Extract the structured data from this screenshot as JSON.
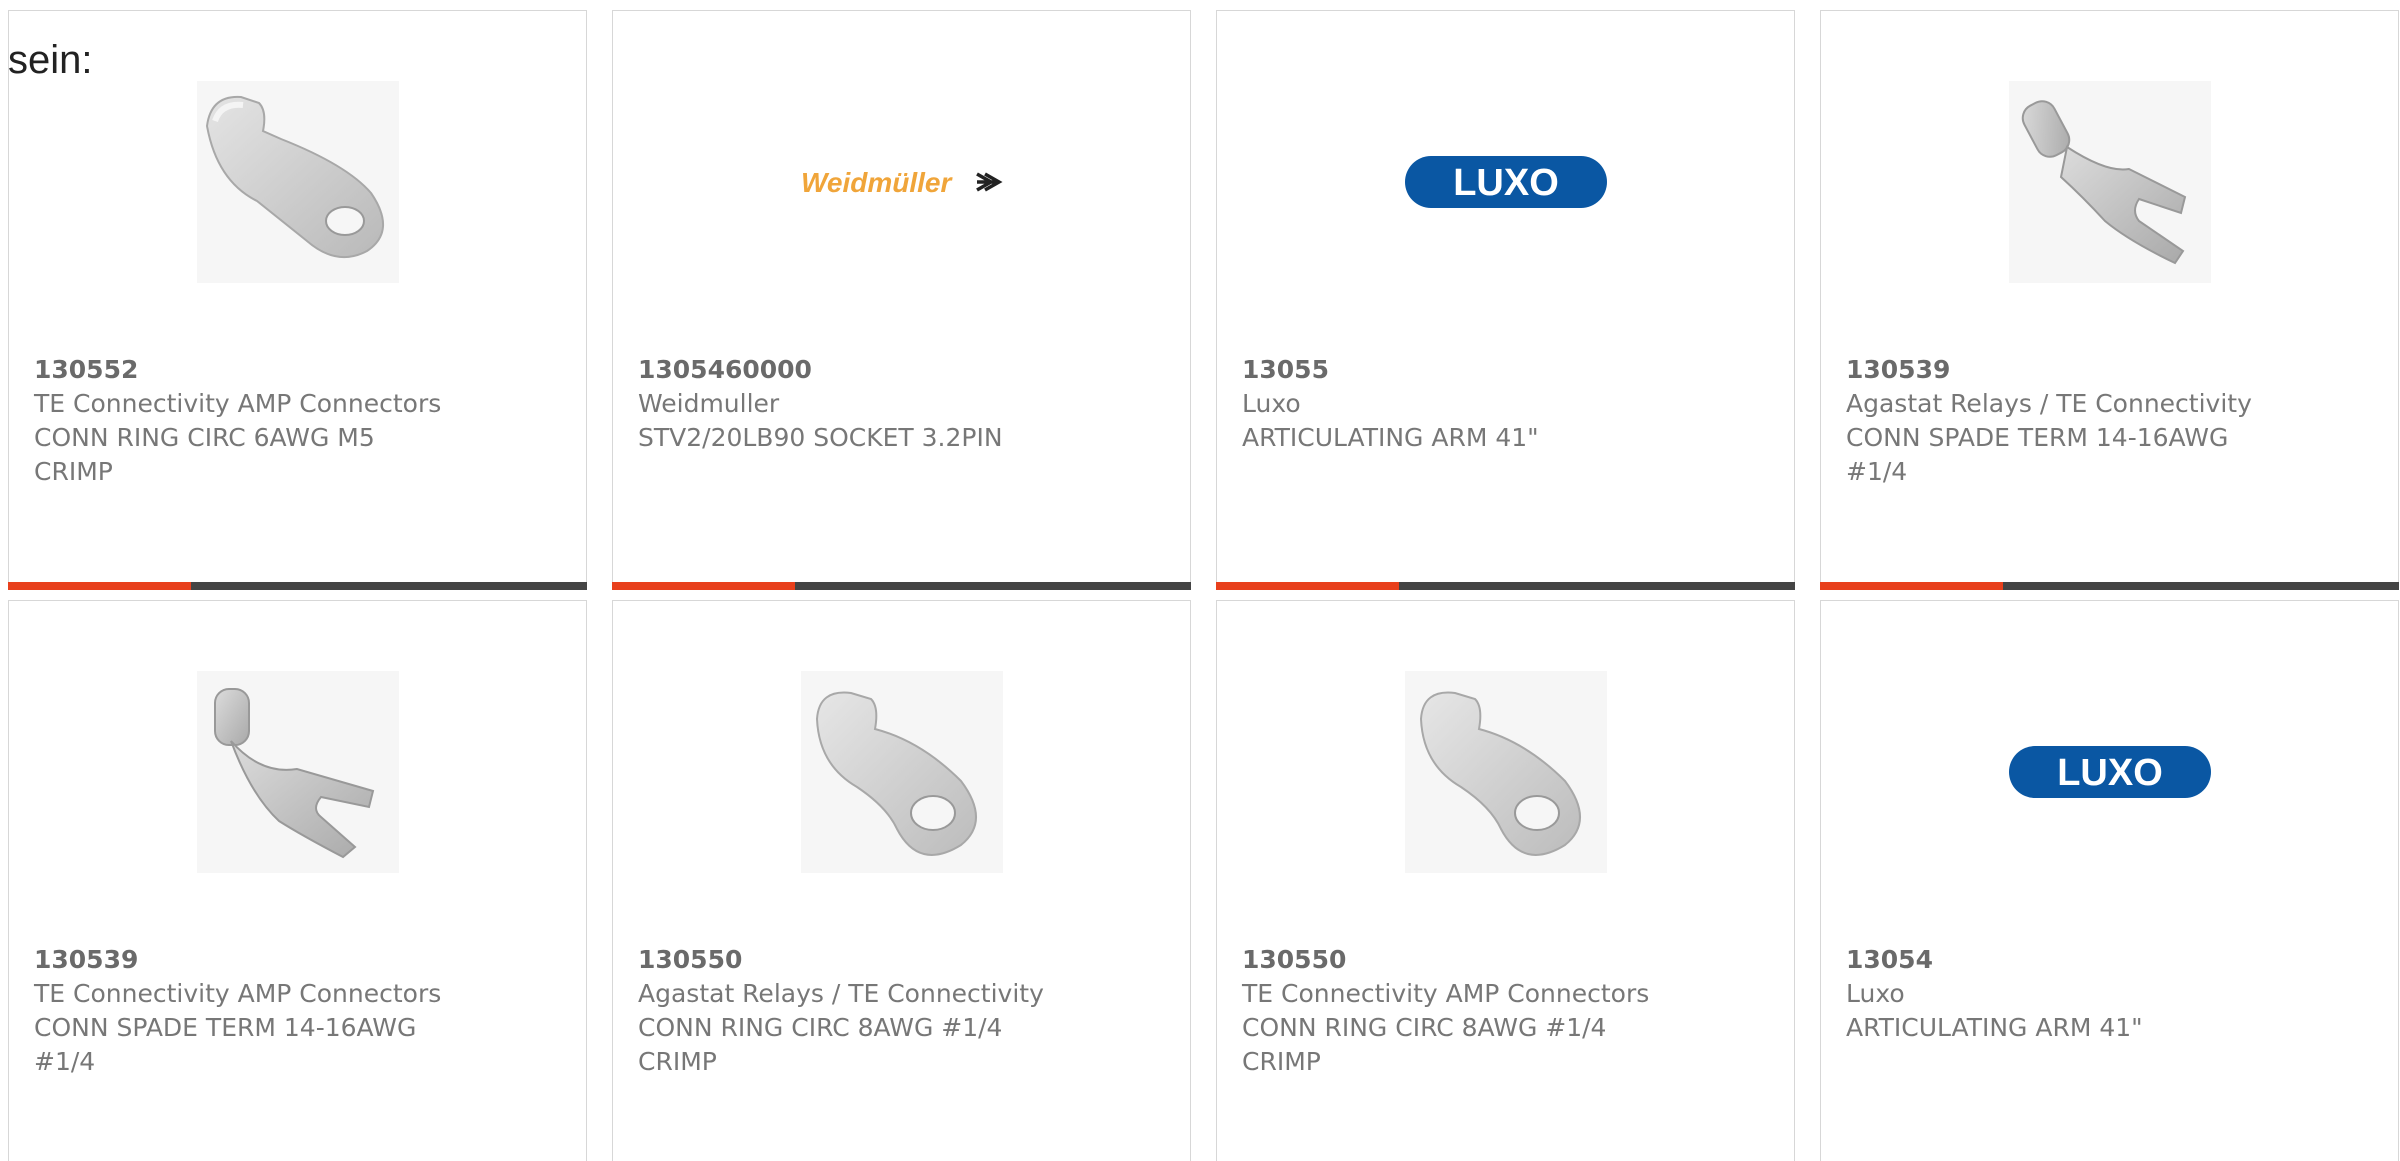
{
  "intro_text": "sein:",
  "accent_color": "#e8401c",
  "products": [
    {
      "part": "130552",
      "maker": "TE Connectivity AMP Connectors",
      "desc": "CONN RING CIRC 6AWG M5 CRIMP",
      "image": "ring-terminal-long-icon"
    },
    {
      "part": "1305460000",
      "maker": "Weidmuller",
      "desc": "STV2/20LB90 SOCKET 3.2PIN",
      "image": "weidmuller-logo",
      "logo_text": "Weidmüller"
    },
    {
      "part": "13055",
      "maker": "Luxo",
      "desc": "ARTICULATING ARM 41\"",
      "image": "luxo-logo",
      "logo_text": "LUXO"
    },
    {
      "part": "130539",
      "maker": "Agastat Relays / TE Connectivity",
      "desc": "CONN SPADE TERM 14-16AWG #1/4",
      "image": "spade-terminal-icon"
    },
    {
      "part": "130539",
      "maker": "TE Connectivity AMP Connectors",
      "desc": "CONN SPADE TERM 14-16AWG #1/4",
      "image": "spade-terminal-icon"
    },
    {
      "part": "130550",
      "maker": "Agastat Relays / TE Connectivity",
      "desc": "CONN RING CIRC 8AWG #1/4 CRIMP",
      "image": "ring-terminal-icon"
    },
    {
      "part": "130550",
      "maker": "TE Connectivity AMP Connectors",
      "desc": "CONN RING CIRC 8AWG #1/4 CRIMP",
      "image": "ring-terminal-icon"
    },
    {
      "part": "13054",
      "maker": "Luxo",
      "desc": "ARTICULATING ARM 41\"",
      "image": "luxo-logo",
      "logo_text": "LUXO"
    }
  ]
}
